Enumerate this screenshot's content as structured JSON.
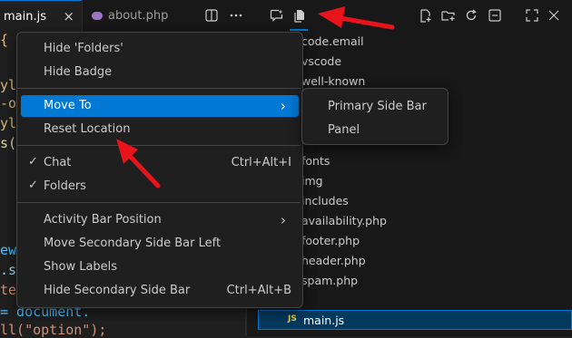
{
  "tabs": [
    {
      "label": "main.js",
      "close": "×"
    },
    {
      "label": "about.php"
    }
  ],
  "editor": {
    "lines": [
      {
        "text": "{",
        "color": "#e2c08d"
      },
      {
        "text": "yl",
        "color": "#d7ba7d"
      },
      {
        "text": "-o",
        "color": "#d7ba7d"
      },
      {
        "text": "yl",
        "color": "#d7ba7d"
      },
      {
        "text": "s(",
        "color": "#dcdcaa"
      },
      {
        "text": "ew",
        "color": "#4fc1ff"
      },
      {
        "text": ".s",
        "color": "#9cdcfe"
      },
      {
        "text": "te",
        "color": "#ce9178"
      },
      {
        "text": "= document.",
        "color": "#4fc1ff"
      },
      {
        "text": "ll(\"option\");",
        "color": "#ce9178"
      }
    ]
  },
  "explorer": {
    "items": [
      "code.email",
      "vscode",
      "well-known",
      "fonts",
      "img",
      "includes",
      "availability.php",
      "footer.php",
      "header.php",
      "spam.php",
      "main.js"
    ],
    "js_badge": "JS"
  },
  "context_menu": {
    "items": [
      {
        "label": "Hide 'Folders'"
      },
      {
        "label": "Hide Badge"
      },
      {
        "label": "Move To",
        "submenu": true
      },
      {
        "label": "Reset Location"
      },
      {
        "label": "Chat",
        "checked": true,
        "shortcut": "Ctrl+Alt+I"
      },
      {
        "label": "Folders",
        "checked": true
      },
      {
        "label": "Activity Bar Position",
        "submenu": true
      },
      {
        "label": "Move Secondary Side Bar Left"
      },
      {
        "label": "Show Labels"
      },
      {
        "label": "Hide Secondary Side Bar",
        "shortcut": "Ctrl+Alt+B"
      }
    ],
    "check_glyph": "✓",
    "arrow_glyph": "›"
  },
  "submenu": {
    "items": [
      "Primary Side Bar",
      "Panel"
    ]
  },
  "colors": {
    "accent": "#0078d4",
    "arrow": "#e8131b",
    "background": "#1f1f1f"
  }
}
